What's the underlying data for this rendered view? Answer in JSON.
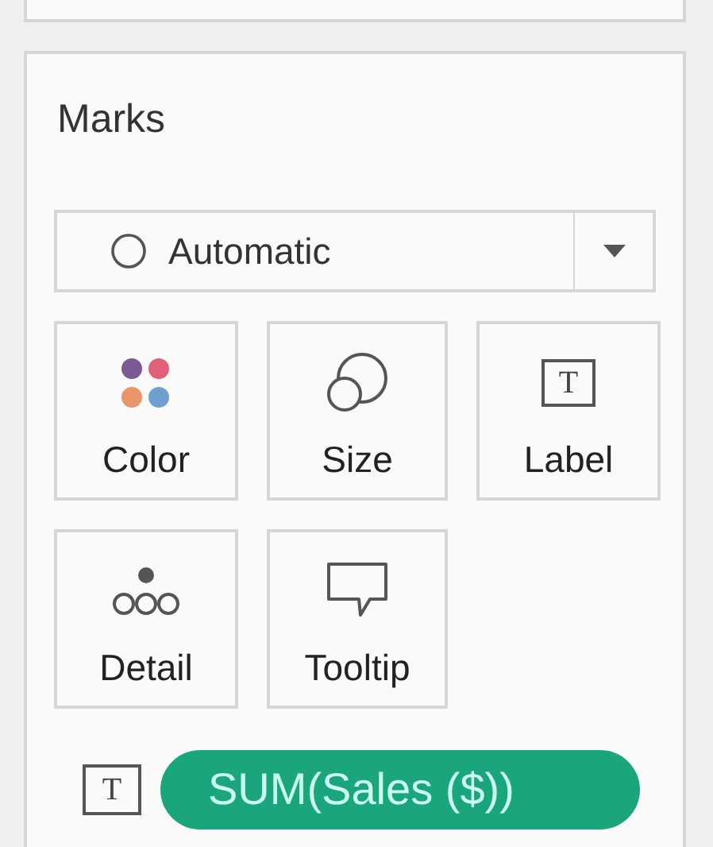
{
  "marks_card": {
    "title": "Marks",
    "mark_type": {
      "value": "Automatic"
    },
    "buttons": [
      {
        "kind": "color",
        "label": "Color"
      },
      {
        "kind": "size",
        "label": "Size"
      },
      {
        "kind": "label",
        "label": "Label",
        "icon_text": "T"
      },
      {
        "kind": "detail",
        "label": "Detail"
      },
      {
        "kind": "tooltip",
        "label": "Tooltip"
      }
    ],
    "fields": [
      {
        "icon_text": "T",
        "label": "SUM(Sales ($))"
      }
    ]
  }
}
